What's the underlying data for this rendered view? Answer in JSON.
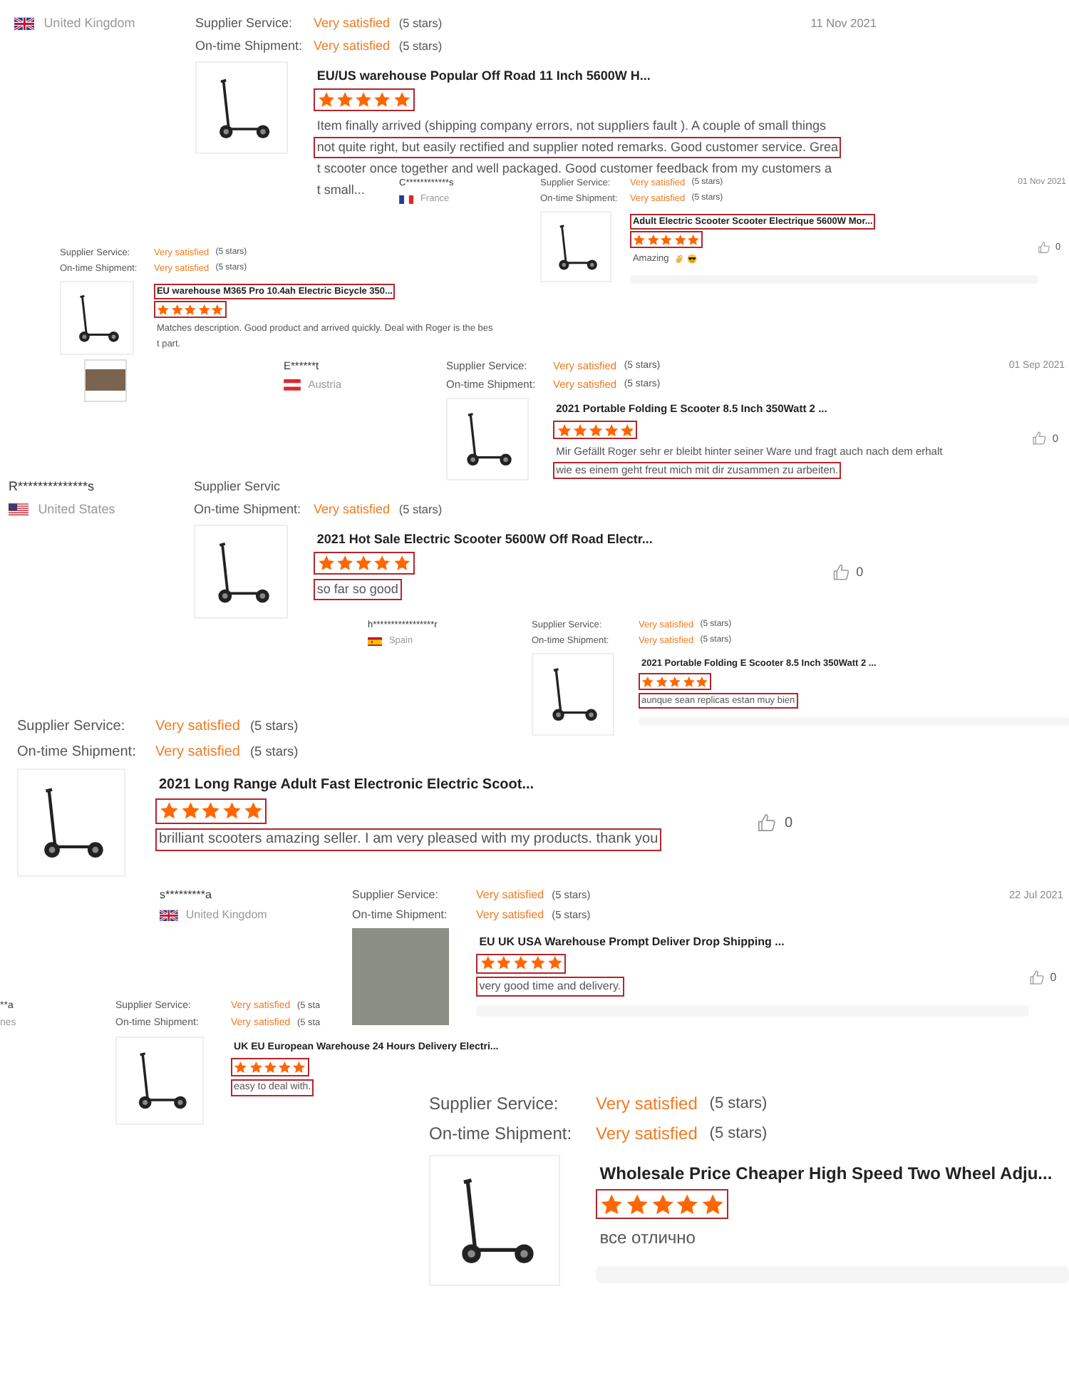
{
  "reviews": [
    {
      "user": {
        "country": "United Kingdom",
        "flag": {
          "kind": "uk"
        }
      },
      "date": "11 Nov 2021",
      "ratings": [
        {
          "label": "Supplier Service:",
          "value": "Very satisfied",
          "note": "(5 stars)"
        },
        {
          "label": "On-time Shipment:",
          "value": "Very satisfied",
          "note": "(5 stars)"
        }
      ],
      "product": {
        "title": {
          "text": "EU/US warehouse Popular Off Road 11 Inch 5600W H...",
          "highlighted": false
        },
        "stars": 5,
        "stars_highlighted": true,
        "comment": [
          {
            "text": "Item finally arrived (shipping company errors, not suppliers fault ). A couple of small things",
            "highlighted": false
          },
          {
            "text": "not quite right, but easily rectified and supplier noted remarks. Good customer service. Grea",
            "highlighted": true
          },
          {
            "text": "t scooter once together and well packaged. Good customer feedback from my customers a",
            "highlighted": false
          },
          {
            "text": "t small...",
            "highlighted": false
          }
        ]
      }
    },
    {
      "user": {
        "name": "C************s",
        "country": "France",
        "flag": {
          "kind": "fr"
        }
      },
      "date": "01 Nov 2021",
      "ratings": [
        {
          "label": "Supplier Service:",
          "value": "Very satisfied",
          "note": "(5 stars)"
        },
        {
          "label": "On-time Shipment:",
          "value": "Very satisfied",
          "note": "(5 stars)"
        }
      ],
      "product": {
        "title": {
          "text": "Adult Electric Scooter Scooter Electrique 5600W Mor...",
          "highlighted": true
        },
        "stars": 5,
        "stars_highlighted": true,
        "comment": [
          {
            "text": "Amazing",
            "highlighted": false
          }
        ],
        "likes": "0"
      }
    },
    {
      "ratings": [
        {
          "label": "Supplier Service:",
          "value": "Very satisfied",
          "note": "(5 stars)"
        },
        {
          "label": "On-time Shipment:",
          "value": "Very satisfied",
          "note": "(5 stars)"
        }
      ],
      "product": {
        "title": {
          "text": "EU warehouse M365 Pro 10.4ah Electric Bicycle 350...",
          "highlighted": true
        },
        "stars": 5,
        "stars_highlighted": true,
        "comment": [
          {
            "text": "Matches description. Good product and arrived quickly. Deal with Roger is the bes",
            "highlighted": false
          },
          {
            "text": "t part.",
            "highlighted": false
          }
        ]
      }
    },
    {
      "user": {
        "name": "E******t",
        "country": "Austria",
        "flag": {
          "kind": "at"
        }
      },
      "date": "01 Sep 2021",
      "ratings": [
        {
          "label": "Supplier Service:",
          "value": "Very satisfied",
          "note": "(5 stars)"
        },
        {
          "label": "On-time Shipment:",
          "value": "Very satisfied",
          "note": "(5 stars)"
        }
      ],
      "product": {
        "title": {
          "text": "2021 Portable Folding E Scooter 8.5 Inch 350Watt 2 ...",
          "highlighted": false
        },
        "stars": 5,
        "stars_highlighted": true,
        "comment": [
          {
            "text": "Mir Gefällt Roger sehr er bleibt hinter seiner Ware und fragt auch nach dem erhalt",
            "highlighted": false
          },
          {
            "text": "wie es einem geht freut mich mit dir zusammen zu arbeiten.",
            "highlighted": true
          }
        ],
        "likes": "0"
      }
    },
    {
      "user": {
        "name": "R**************s",
        "country": "United States",
        "flag": {
          "kind": "us"
        }
      },
      "ratings": [
        {
          "label": "Supplier Servic"
        },
        {
          "label": "On-time Shipment:",
          "value": "Very satisfied",
          "note": "(5 stars)"
        }
      ],
      "product": {
        "title": {
          "text": "2021 Hot Sale Electric Scooter 5600W Off Road Electr...",
          "highlighted": false
        },
        "stars": 5,
        "stars_highlighted": true,
        "comment": [
          {
            "text": "so far so good",
            "highlighted": true
          }
        ],
        "likes": "0"
      }
    },
    {
      "user": {
        "name": "h*****************r",
        "country": "Spain",
        "flag": {
          "kind": "es"
        }
      },
      "ratings": [
        {
          "label": "Supplier Service:",
          "value": "Very satisfied",
          "note": "(5 stars)"
        },
        {
          "label": "On-time Shipment:",
          "value": "Very satisfied",
          "note": "(5 stars)"
        }
      ],
      "product": {
        "title": {
          "text": "2021 Portable Folding E Scooter 8.5 Inch 350Watt 2 ...",
          "highlighted": false
        },
        "stars": 5,
        "stars_highlighted": true,
        "comment": [
          {
            "text": "aunque sean replicas estan muy bien",
            "highlighted": true
          }
        ]
      }
    },
    {
      "ratings": [
        {
          "label": "Supplier Service:",
          "value": "Very satisfied",
          "note": "(5 stars)"
        },
        {
          "label": "On-time Shipment:",
          "value": "Very satisfied",
          "note": "(5 stars)"
        }
      ],
      "product": {
        "title": {
          "text": "2021 Long Range Adult Fast Electronic Electric Scoot...",
          "highlighted": false
        },
        "stars": 5,
        "stars_highlighted": true,
        "comment": [
          {
            "text": "brilliant scooters amazing seller. I am very pleased with my products. thank you",
            "highlighted": true
          }
        ],
        "likes": "0"
      }
    },
    {
      "user": {
        "name": "s*********a",
        "country": "United Kingdom",
        "flag": {
          "kind": "uk"
        }
      },
      "date": "22 Jul 2021",
      "ratings": [
        {
          "label": "Supplier Service:",
          "value": "Very satisfied",
          "note": "(5 stars)"
        },
        {
          "label": "On-time Shipment:",
          "value": "Very satisfied",
          "note": "(5 stars)"
        }
      ],
      "product": {
        "title": {
          "text": "EU UK USA Warehouse Prompt Deliver Drop Shipping ...",
          "highlighted": false
        },
        "stars": 5,
        "stars_highlighted": true,
        "comment": [
          {
            "text": "very good time and delivery.",
            "highlighted": true
          }
        ],
        "likes": "0"
      }
    },
    {
      "user": {
        "name": "**a",
        "country": "nes"
      },
      "ratings": [
        {
          "label": "Supplier Service:",
          "value": "Very satisfied",
          "note": "(5 sta"
        },
        {
          "label": "On-time Shipment:",
          "value": "Very satisfied",
          "note": "(5 sta"
        }
      ],
      "product": {
        "title": {
          "text": "UK EU European Warehouse 24 Hours Delivery Electri...",
          "highlighted": false
        },
        "stars": 5,
        "stars_highlighted": true,
        "comment": [
          {
            "text": "easy to deal with.",
            "highlighted": true
          }
        ]
      }
    },
    {
      "ratings": [
        {
          "label": "Supplier Service:",
          "value": "Very satisfied",
          "note": "(5 stars)"
        },
        {
          "label": "On-time Shipment:",
          "value": "Very satisfied",
          "note": "(5 stars)"
        }
      ],
      "product": {
        "title": {
          "text": "Wholesale Price Cheaper High Speed Two Wheel Adju...",
          "highlighted": false
        },
        "stars": 5,
        "stars_highlighted": true,
        "comment": [
          {
            "text": "все отлично",
            "highlighted": false
          }
        ]
      }
    }
  ]
}
